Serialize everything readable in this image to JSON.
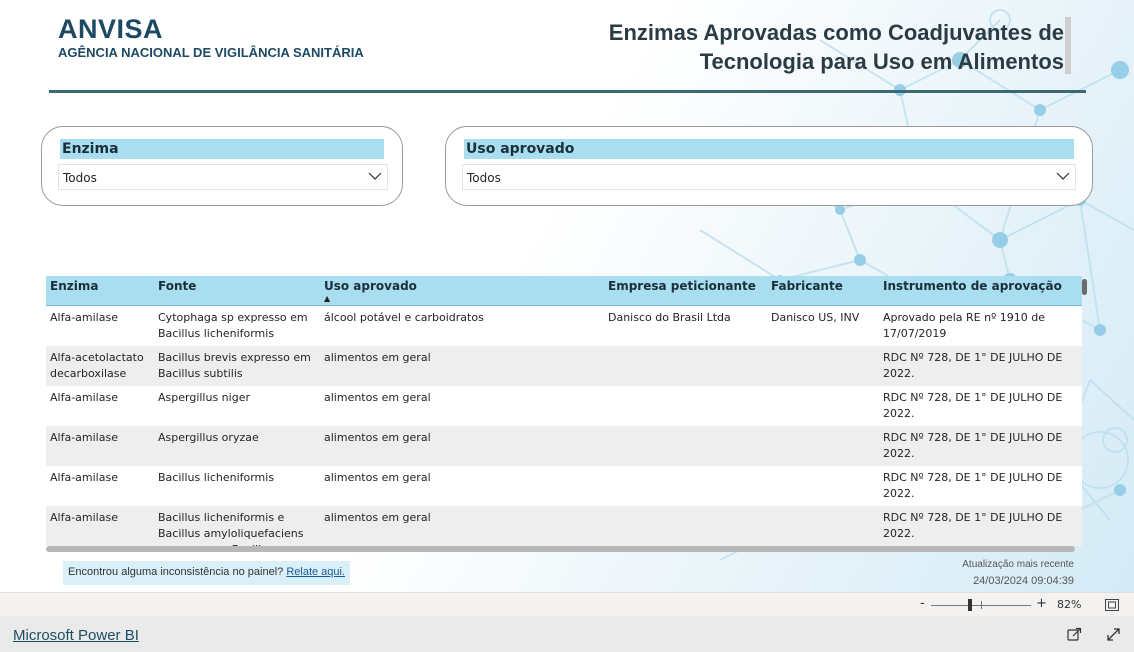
{
  "header": {
    "logo_title": "ANVISA",
    "logo_subtitle": "AGÊNCIA NACIONAL DE VIGILÂNCIA SANITÁRIA",
    "report_title_line1": "Enzimas Aprovadas como Coadjuvantes de",
    "report_title_line2": "Tecnologia para Uso em Alimentos"
  },
  "filters": {
    "enzima": {
      "title": "Enzima",
      "value": "Todos",
      "icon": "chevron-down-icon"
    },
    "uso": {
      "title": "Uso aprovado",
      "value": "Todos",
      "icon": "chevron-down-icon"
    }
  },
  "table": {
    "columns": [
      "Enzima",
      "Fonte",
      "Uso aprovado",
      "Empresa peticionante",
      "Fabricante",
      "Instrumento de aprovação"
    ],
    "sorted_column": "Uso aprovado",
    "sort_direction": "ascending",
    "rows": [
      [
        "Alfa-amilase",
        "Cytophaga sp expresso em Bacillus licheniformis",
        "álcool potável e carboidratos",
        "Danisco do Brasil Ltda",
        "Danisco US, INV",
        "Aprovado pela RE nº 1910 de 17/07/2019"
      ],
      [
        "Alfa-acetolactato decarboxilase",
        "Bacillus brevis expresso em Bacillus subtilis",
        "alimentos em geral",
        "",
        "",
        "RDC Nº 728, DE 1° DE JULHO DE 2022."
      ],
      [
        "Alfa-amilase",
        "Aspergillus niger",
        "alimentos em geral",
        "",
        "",
        "RDC Nº 728, DE 1° DE JULHO DE 2022."
      ],
      [
        "Alfa-amilase",
        "Aspergillus oryzae",
        "alimentos em geral",
        "",
        "",
        "RDC Nº 728, DE 1° DE JULHO DE 2022."
      ],
      [
        "Alfa-amilase",
        "Bacillus licheniformis",
        "alimentos em geral",
        "",
        "",
        "RDC Nº 728, DE 1° DE JULHO DE 2022."
      ],
      [
        "Alfa-amilase",
        "Bacillus licheniformis e Bacillus amyloliquefaciens expresso em Bacillus licheniformis",
        "alimentos em geral",
        "",
        "",
        "RDC Nº 728, DE 1° DE JULHO DE 2022."
      ]
    ]
  },
  "feedback": {
    "text": "Encontrou alguma inconsistência no painel?",
    "link": "Relate aqui."
  },
  "update": {
    "label": "Atualização mais recente",
    "date": "24/03/2024 09:04:39"
  },
  "zoom": {
    "minus": "-",
    "plus": "+",
    "level": "82%",
    "level_value": 0.82
  },
  "footer": {
    "powerbi_link": "Microsoft Power BI",
    "share_icon": "share-icon",
    "expand_icon": "fullscreen-icon"
  },
  "colors": {
    "accent_header": "#a8def0",
    "brand_dark": "#1d4a63",
    "rule": "#3b6a72",
    "link": "#1c4e63"
  }
}
